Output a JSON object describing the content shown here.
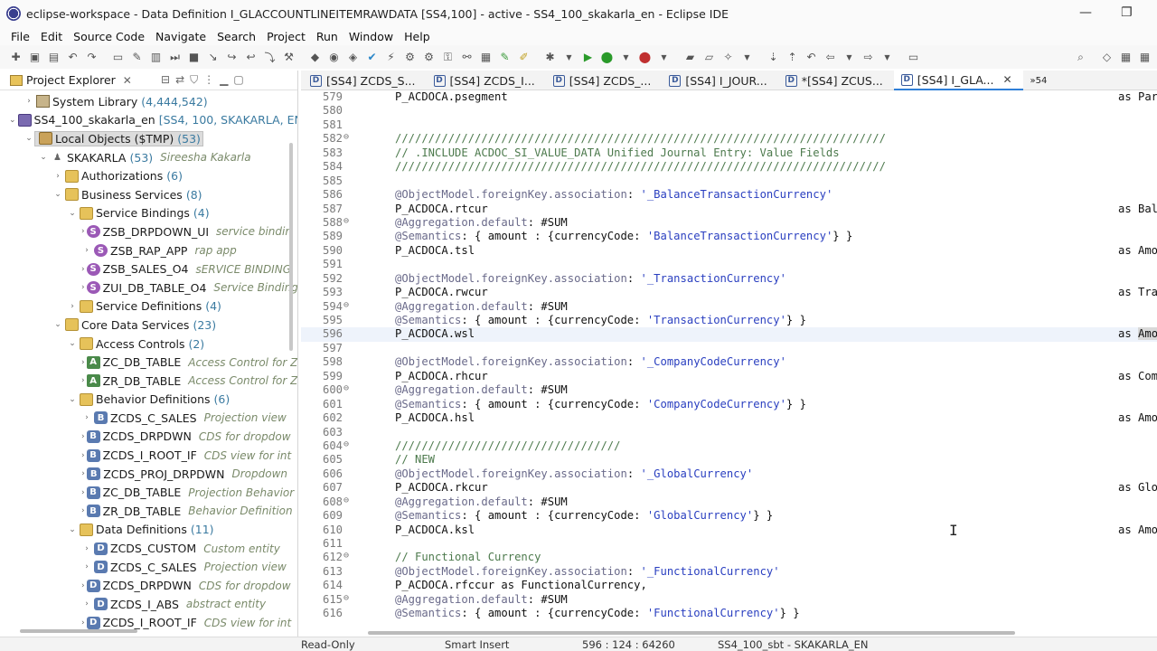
{
  "window": {
    "title": "eclipse-workspace - Data Definition I_GLACCOUNTLINEITEMRAWDATA [SS4,100] - active - SS4_100_skakarla_en - Eclipse IDE",
    "minimize": "—",
    "restore": "❐"
  },
  "menu": [
    "File",
    "Edit",
    "Source Code",
    "Navigate",
    "Search",
    "Project",
    "Run",
    "Window",
    "Help"
  ],
  "explorer": {
    "title": "Project Explorer",
    "close": "✕",
    "nodes": [
      {
        "label": "System Library",
        "count": "(4,444,542)",
        "desc": ""
      },
      {
        "label": "SS4_100_skakarla_en",
        "count": "[SS4, 100, SKAKARLA, EN]",
        "desc": ""
      },
      {
        "label": "Local Objects ($TMP)",
        "count": "(53)",
        "desc": ""
      },
      {
        "label": "SKAKARLA",
        "count": "(53)",
        "desc": "Sireesha Kakarla"
      },
      {
        "label": "Authorizations",
        "count": "(6)",
        "desc": ""
      },
      {
        "label": "Business Services",
        "count": "(8)",
        "desc": ""
      },
      {
        "label": "Service Bindings",
        "count": "(4)",
        "desc": ""
      },
      {
        "label": "ZSB_DRPDOWN_UI",
        "count": "",
        "desc": "service bindin"
      },
      {
        "label": "ZSB_RAP_APP",
        "count": "",
        "desc": "rap app"
      },
      {
        "label": "ZSB_SALES_O4",
        "count": "",
        "desc": "sERVICE BINDING"
      },
      {
        "label": "ZUI_DB_TABLE_O4",
        "count": "",
        "desc": "Service Binding"
      },
      {
        "label": "Service Definitions",
        "count": "(4)",
        "desc": ""
      },
      {
        "label": "Core Data Services",
        "count": "(23)",
        "desc": ""
      },
      {
        "label": "Access Controls",
        "count": "(2)",
        "desc": ""
      },
      {
        "label": "ZC_DB_TABLE",
        "count": "",
        "desc": "Access Control for Z"
      },
      {
        "label": "ZR_DB_TABLE",
        "count": "",
        "desc": "Access Control for Z"
      },
      {
        "label": "Behavior Definitions",
        "count": "(6)",
        "desc": ""
      },
      {
        "label": "ZCDS_C_SALES",
        "count": "",
        "desc": "Projection view"
      },
      {
        "label": "ZCDS_DRPDWN",
        "count": "",
        "desc": "CDS for dropdow"
      },
      {
        "label": "ZCDS_I_ROOT_IF",
        "count": "",
        "desc": "CDS view for int"
      },
      {
        "label": "ZCDS_PROJ_DRPDWN",
        "count": "",
        "desc": "Dropdown"
      },
      {
        "label": "ZC_DB_TABLE",
        "count": "",
        "desc": "Projection Behavior"
      },
      {
        "label": "ZR_DB_TABLE",
        "count": "",
        "desc": "Behavior Definition"
      },
      {
        "label": "Data Definitions",
        "count": "(11)",
        "desc": ""
      },
      {
        "label": "ZCDS_CUSTOM",
        "count": "",
        "desc": "Custom entity"
      },
      {
        "label": "ZCDS_C_SALES",
        "count": "",
        "desc": "Projection view"
      },
      {
        "label": "ZCDS_DRPDWN",
        "count": "",
        "desc": "CDS for dropdow"
      },
      {
        "label": "ZCDS_I_ABS",
        "count": "",
        "desc": "abstract entity"
      },
      {
        "label": "ZCDS_I_ROOT_IF",
        "count": "",
        "desc": "CDS view for int"
      }
    ]
  },
  "tabs": [
    {
      "label": "[SS4] ZCDS_S...",
      "active": false
    },
    {
      "label": "[SS4] ZCDS_I...",
      "active": false
    },
    {
      "label": "[SS4] ZCDS_...",
      "active": false
    },
    {
      "label": "[SS4] I_JOUR...",
      "active": false
    },
    {
      "label": "*[SS4] ZCUS...",
      "active": false
    },
    {
      "label": "[SS4] I_GLA...",
      "active": true
    }
  ],
  "tabs_overflow": "»54",
  "code": [
    {
      "n": "579",
      "t": "P_ACDOCA.psegment",
      "a": "as Par"
    },
    {
      "n": "580",
      "t": "",
      "a": ""
    },
    {
      "n": "581",
      "t": "",
      "a": ""
    },
    {
      "n": "582",
      "t": "//////////////////////////////////////////////////////////////////////////",
      "a": "",
      "fold": true
    },
    {
      "n": "583",
      "t": "// .INCLUDE ACDOC_SI_VALUE_DATA Unified Journal Entry: Value Fields",
      "a": ""
    },
    {
      "n": "584",
      "t": "//////////////////////////////////////////////////////////////////////////",
      "a": ""
    },
    {
      "n": "585",
      "t": "",
      "a": ""
    },
    {
      "n": "586",
      "t": "@ObjectModel.foreignKey.association: '_BalanceTransactionCurrency'",
      "a": ""
    },
    {
      "n": "587",
      "t": "P_ACDOCA.rtcur",
      "a": "as Bal"
    },
    {
      "n": "588",
      "t": "@Aggregation.default: #SUM",
      "a": "",
      "fold": true
    },
    {
      "n": "589",
      "t": "@Semantics: { amount : {currencyCode: 'BalanceTransactionCurrency'} }",
      "a": ""
    },
    {
      "n": "590",
      "t": "P_ACDOCA.tsl",
      "a": "as Amo"
    },
    {
      "n": "591",
      "t": "",
      "a": ""
    },
    {
      "n": "592",
      "t": "@ObjectModel.foreignKey.association: '_TransactionCurrency'",
      "a": ""
    },
    {
      "n": "593",
      "t": "P_ACDOCA.rwcur",
      "a": "as Tra"
    },
    {
      "n": "594",
      "t": "@Aggregation.default: #SUM",
      "a": "",
      "fold": true
    },
    {
      "n": "595",
      "t": "@Semantics: { amount : {currencyCode: 'TransactionCurrency'} }",
      "a": ""
    },
    {
      "n": "596",
      "t": "P_ACDOCA.wsl",
      "a": "as Amo",
      "cur": true
    },
    {
      "n": "597",
      "t": "",
      "a": ""
    },
    {
      "n": "598",
      "t": "@ObjectModel.foreignKey.association: '_CompanyCodeCurrency'",
      "a": ""
    },
    {
      "n": "599",
      "t": "P_ACDOCA.rhcur",
      "a": "as Com"
    },
    {
      "n": "600",
      "t": "@Aggregation.default: #SUM",
      "a": "",
      "fold": true
    },
    {
      "n": "601",
      "t": "@Semantics: { amount : {currencyCode: 'CompanyCodeCurrency'} }",
      "a": ""
    },
    {
      "n": "602",
      "t": "P_ACDOCA.hsl",
      "a": "as Amo"
    },
    {
      "n": "603",
      "t": "",
      "a": ""
    },
    {
      "n": "604",
      "t": "//////////////////////////////////",
      "a": "",
      "fold": true
    },
    {
      "n": "605",
      "t": "// NEW",
      "a": ""
    },
    {
      "n": "606",
      "t": "@ObjectModel.foreignKey.association: '_GlobalCurrency'",
      "a": ""
    },
    {
      "n": "607",
      "t": "P_ACDOCA.rkcur",
      "a": "as Glo"
    },
    {
      "n": "608",
      "t": "@Aggregation.default: #SUM",
      "a": "",
      "fold": true
    },
    {
      "n": "609",
      "t": "@Semantics: { amount : {currencyCode: 'GlobalCurrency'} }",
      "a": ""
    },
    {
      "n": "610",
      "t": "P_ACDOCA.ksl",
      "a": "as Amo"
    },
    {
      "n": "611",
      "t": "",
      "a": ""
    },
    {
      "n": "612",
      "t": "// Functional Currency",
      "a": "",
      "fold": true
    },
    {
      "n": "613",
      "t": "@ObjectModel.foreignKey.association: '_FunctionalCurrency'",
      "a": ""
    },
    {
      "n": "614",
      "t": "P_ACDOCA.rfccur as FunctionalCurrency,",
      "a": ""
    },
    {
      "n": "615",
      "t": "@Aggregation.default: #SUM",
      "a": "",
      "fold": true
    },
    {
      "n": "616",
      "t": "@Semantics: { amount : {currencyCode: 'FunctionalCurrency'} }",
      "a": ""
    }
  ],
  "status": {
    "mode": "Read-Only",
    "insert": "Smart Insert",
    "position": "596 : 124 : 64260",
    "system": "SS4_100_sbt - SKAKARLA_EN"
  }
}
